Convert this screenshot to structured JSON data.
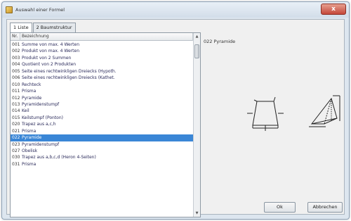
{
  "window": {
    "title": "Auswahl einer Formel",
    "close_label": "x"
  },
  "tabs": [
    {
      "label": "1 Liste"
    },
    {
      "label": "2 Baumstruktur"
    }
  ],
  "list": {
    "columns": [
      "Nr.",
      "Bezeichnung"
    ],
    "rows": [
      {
        "nr": "001",
        "desc": "Summe von max. 4 Werten"
      },
      {
        "nr": "002",
        "desc": "Produkt von max. 4 Werten"
      },
      {
        "nr": "003",
        "desc": "Produkt von 2 Summen"
      },
      {
        "nr": "004",
        "desc": "Quotient von 2 Produkten"
      },
      {
        "nr": "005",
        "desc": "Seite eines rechtwinkligen Dreiecks (Hypoth."
      },
      {
        "nr": "006",
        "desc": "Seite eines rechtwinkligen Dreiecks (Kathet."
      },
      {
        "nr": "010",
        "desc": "Rechteck"
      },
      {
        "nr": "011",
        "desc": "  Prisma"
      },
      {
        "nr": "012",
        "desc": "  Pyramide"
      },
      {
        "nr": "013",
        "desc": "  Pyramidenstumpf"
      },
      {
        "nr": "014",
        "desc": "  Keil"
      },
      {
        "nr": "015",
        "desc": "  Keilstumpf (Ponton)"
      },
      {
        "nr": "020",
        "desc": "Trapez aus a,c,h"
      },
      {
        "nr": "021",
        "desc": "  Prisma"
      },
      {
        "nr": "022",
        "desc": "  Pyramide"
      },
      {
        "nr": "023",
        "desc": "  Pyramidenstumpf"
      },
      {
        "nr": "027",
        "desc": "  Obelisk"
      },
      {
        "nr": "030",
        "desc": "Trapez aus a,b,c,d (Heron 4-Seiten)"
      },
      {
        "nr": "031",
        "desc": "  Prisma"
      }
    ],
    "selected_index": 14
  },
  "preview": {
    "title": "022 Pyramide",
    "icons": [
      "trapezoid-base-icon",
      "pyramid-solid-icon"
    ]
  },
  "buttons": {
    "ok_label": "Ok",
    "cancel_label": "Abbrechen"
  }
}
